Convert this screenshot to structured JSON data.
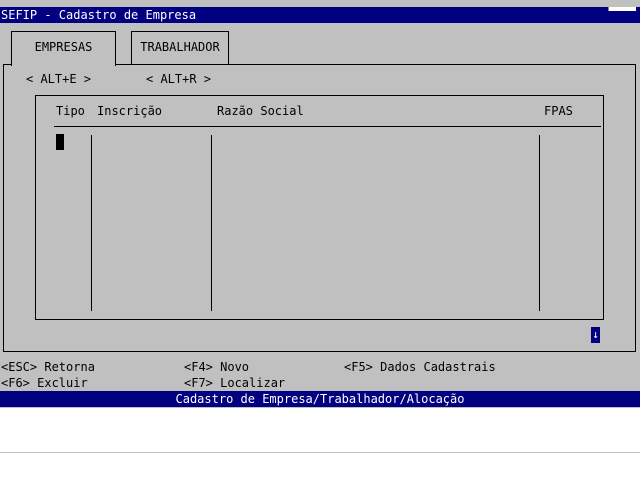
{
  "window": {
    "title": "SEFIP - Cadastro de Empresa"
  },
  "tabs": [
    {
      "label": "EMPRESAS",
      "active": true
    },
    {
      "label": "TRABALHADOR",
      "active": false
    }
  ],
  "hotkeys": {
    "empresas": "< ALT+E >",
    "trabalhador": "< ALT+R >"
  },
  "grid": {
    "columns": [
      "Tipo",
      "Inscrição",
      "Razão Social",
      "FPAS"
    ],
    "rows": []
  },
  "scroll_indicator": "↓",
  "function_keys": {
    "esc": "<ESC> Retorna",
    "f4": "<F4> Novo",
    "f5": "<F5> Dados Cadastrais",
    "f6": "<F6> Excluir",
    "f7": "<F7> Localizar"
  },
  "status_bar": "Cadastro de Empresa/Trabalhador/Alocação",
  "colors": {
    "background": "#c0c0c0",
    "title_bar": "#000080",
    "title_text": "#ffffff"
  }
}
